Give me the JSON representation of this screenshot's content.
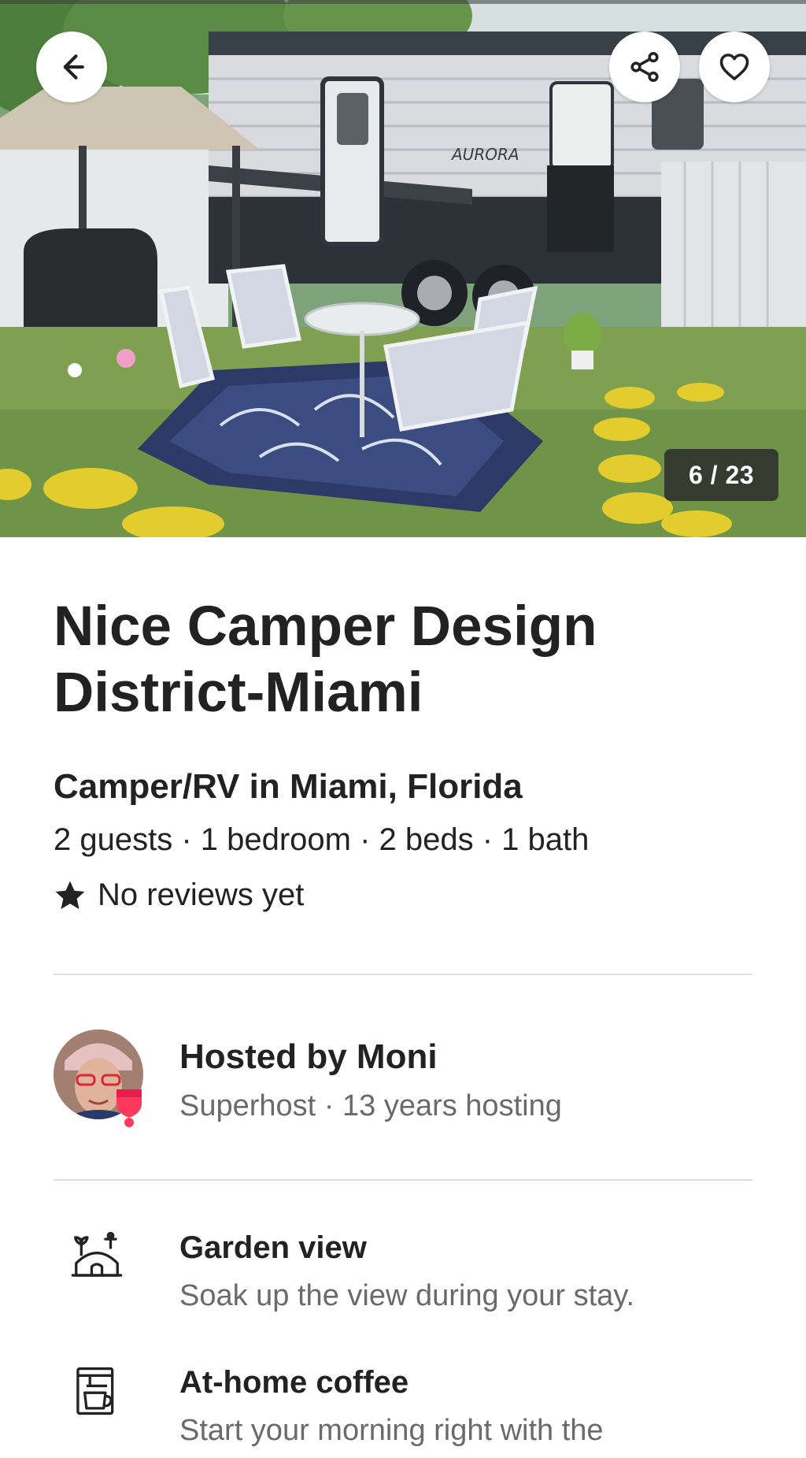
{
  "gallery": {
    "counter": "6 / 23",
    "current": 6,
    "total": 23,
    "trailer_brand": "AURORA"
  },
  "nav": {
    "back_icon": "arrow-left-icon",
    "share_icon": "share-icon",
    "save_icon": "heart-icon"
  },
  "listing": {
    "title": "Nice Camper Design District-Miami",
    "subtitle": "Camper/RV in Miami, Florida",
    "details": "2 guests · 1 bedroom · 2 beds · 1 bath",
    "reviews": "No reviews yet"
  },
  "host": {
    "name": "Hosted by Moni",
    "info": "Superhost · 13 years hosting"
  },
  "amenities": [
    {
      "icon": "garden-view-icon",
      "name": "Garden view",
      "description": "Soak up the view during your stay."
    },
    {
      "icon": "coffee-maker-icon",
      "name": "At-home coffee",
      "description": "Start your morning right with the"
    }
  ],
  "colors": {
    "text": "#222222",
    "secondary_text": "#6a6a6a",
    "divider": "#dddddd",
    "superhost_badge": "#ff385c"
  }
}
